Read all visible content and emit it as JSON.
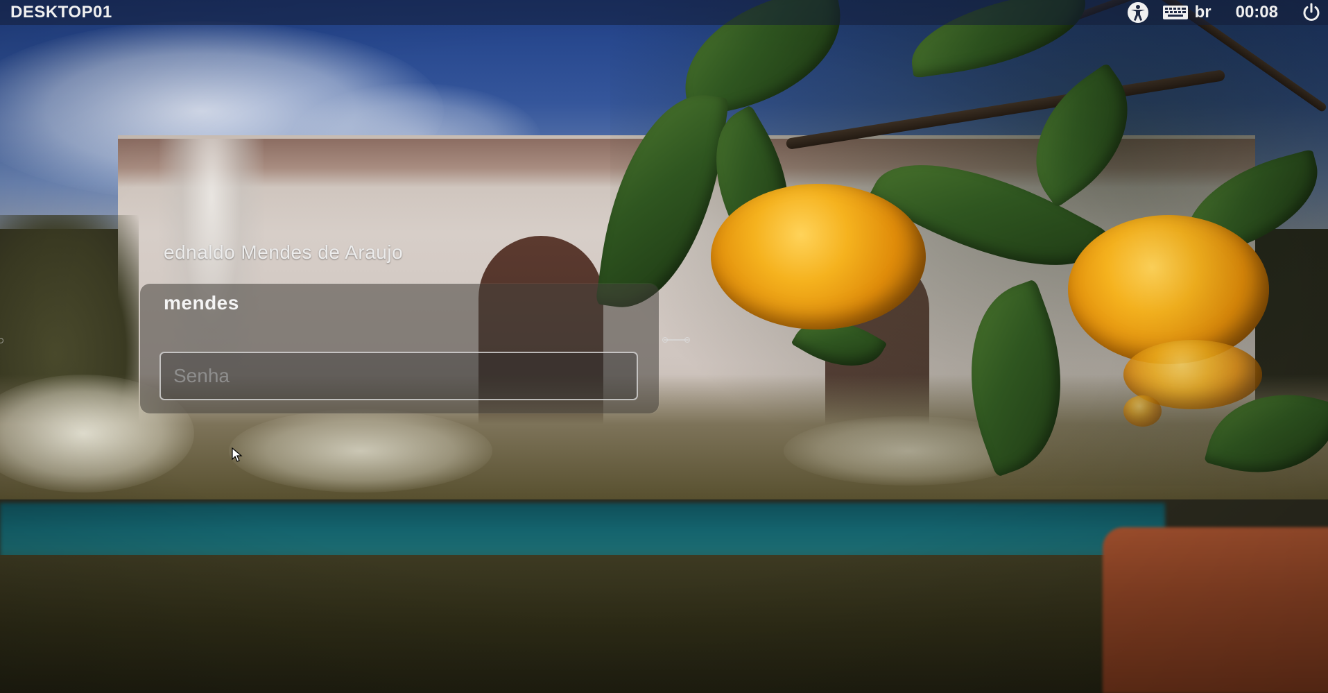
{
  "top_panel": {
    "hostname": "DESKTOP01",
    "indicators": {
      "accessibility_icon": "accessibility-icon",
      "keyboard_icon": "keyboard-icon",
      "keyboard_layout": "br",
      "clock": "00:08",
      "power_icon": "power-icon"
    }
  },
  "greeter": {
    "other_user": "ednaldo Mendes de Araujo",
    "selected_user": "mendes",
    "password_field": {
      "value": "",
      "placeholder": "Senha"
    }
  },
  "colors": {
    "panel_bg": "#141e37",
    "login_box_bg": "#46423c",
    "text": "#f0f0f0",
    "placeholder": "#969696"
  }
}
